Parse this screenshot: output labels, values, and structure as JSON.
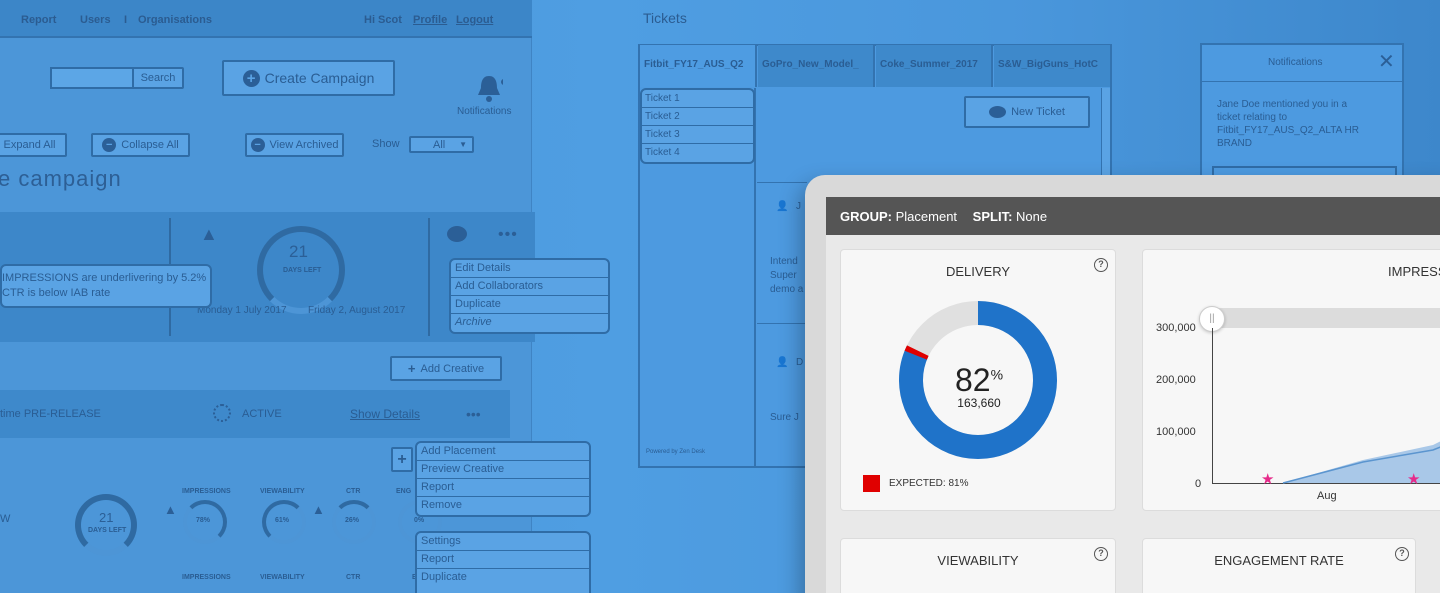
{
  "left": {
    "nav": {
      "report": "Report",
      "users": "Users",
      "sep": "I",
      "organisations": "Organisations",
      "greeting": "Hi Scot",
      "profile": "Profile",
      "logout": "Logout"
    },
    "search_label": "Search",
    "create_label": "Create Campaign",
    "notifications_label": "Notifications",
    "expand_all": "Expand All",
    "collapse_all": "Collapse All",
    "view_archived": "View Archived",
    "show_label": "Show",
    "show_value": "All",
    "heading": "e campaign",
    "tooltip_line1": "IMPRESSIONS are underlivering by 5.2%",
    "tooltip_line2": "CTR is below IAB rate",
    "donut_value": "21",
    "donut_unit": "DAYS LEFT",
    "date_start": "Monday 1 July 2017",
    "date_end": "Friday 2, August 2017",
    "menu1": [
      "Edit Details",
      "Add Collaborators",
      "Duplicate",
      "Archive"
    ],
    "add_creative": "Add Creative",
    "row_title": "time PRE-RELEASE",
    "row_status": "ACTIVE",
    "row_show": "Show Details",
    "menu2": [
      "Add Placement",
      "Preview Creative",
      "Report",
      "Remove"
    ],
    "menu3": [
      "Settings",
      "Report",
      "Duplicate"
    ],
    "metric_labels": [
      "IMPRESSIONS",
      "VIEWABILITY",
      "CTR",
      "ENG"
    ],
    "metric_values": [
      "78%",
      "61%",
      "26%",
      "0%"
    ],
    "row_prefix": "W",
    "donut2_value": "21",
    "donut2_unit": "DAYS LEFT"
  },
  "tickets": {
    "title": "Tickets",
    "tabs": [
      "Fitbit_FY17_AUS_Q2",
      "GoPro_New_Model_",
      "Coke_Summer_2017",
      "S&W_BigGuns_HotC"
    ],
    "list": [
      "Ticket 1",
      "Ticket 2",
      "Ticket 3",
      "Ticket 4"
    ],
    "new_ticket": "New Ticket",
    "msg1_name": "J",
    "msg1_text": [
      "Intend",
      "Super",
      "demo a"
    ],
    "msg2_name": "D",
    "msg2_text": "Sure J",
    "footer": "Powered by Zen Desk"
  },
  "notifications": {
    "title": "Notifications",
    "body": [
      "Jane Doe mentioned you in a",
      "ticket relating to",
      "Fitbit_FY17_AUS_Q2_ALTA HR",
      "BRAND"
    ]
  },
  "dashboard": {
    "group_label": "GROUP:",
    "group_value": "Placement",
    "split_label": "SPLIT:",
    "split_value": "None",
    "delivery": {
      "title": "DELIVERY",
      "percent": "82",
      "percent_symbol": "%",
      "count": "163,660",
      "expected_label": "EXPECTED: 81%",
      "fraction": 0.82,
      "expected_fraction": 0.81,
      "color_fill": "#1f73c9",
      "color_track": "#e0e0e0",
      "color_expected": "#e00000"
    },
    "impressions": {
      "title": "IMPRESS",
      "y_ticks": [
        "300,000",
        "200,000",
        "100,000",
        "0"
      ],
      "x_label": "Aug"
    },
    "viewability_title": "VIEWABILITY",
    "engagement_title": "ENGAGEMENT RATE",
    "help_glyph": "?"
  }
}
